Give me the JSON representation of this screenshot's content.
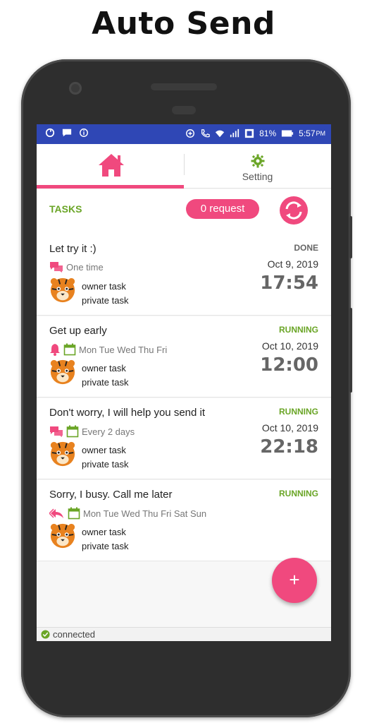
{
  "promo": {
    "title": "Auto Send"
  },
  "statusbar": {
    "left_icons": [
      "sync-icon",
      "chat-icon",
      "info-icon"
    ],
    "right_icons": [
      "data-saver-icon",
      "call-icon",
      "wifi-icon",
      "signal-icon",
      "signal-icon-2",
      "battery-icon"
    ],
    "battery": "81%",
    "time": "5:57",
    "ampm": "PM"
  },
  "tabs": {
    "home_icon": "home-icon",
    "setting_icon": "gear-icon",
    "setting_label": "Setting"
  },
  "header": {
    "tasks_label": "TASKS",
    "request_label": "0 request",
    "refresh_icon": "refresh-icon"
  },
  "tasks": [
    {
      "title": "Let try it :)",
      "icons": [
        "chat-icon"
      ],
      "schedule": "One time",
      "owner": "owner task",
      "privacy": "private task",
      "status": "DONE",
      "date": "Oct 9, 2019",
      "time": "17:54"
    },
    {
      "title": "Get up early",
      "icons": [
        "bell-icon",
        "calendar-icon"
      ],
      "schedule": "Mon Tue Wed Thu Fri",
      "owner": "owner task",
      "privacy": "private task",
      "status": "RUNNING",
      "date": "Oct 10, 2019",
      "time": "12:00"
    },
    {
      "title": "Don't worry, I will help you send it",
      "icons": [
        "chat-icon",
        "calendar-icon"
      ],
      "schedule": "Every 2 days",
      "owner": "owner task",
      "privacy": "private task",
      "status": "RUNNING",
      "date": "Oct 10, 2019",
      "time": "22:18"
    },
    {
      "title": "Sorry, I busy. Call me later",
      "icons": [
        "reply-all-icon",
        "calendar-icon"
      ],
      "schedule": "Mon Tue Wed Thu Fri Sat Sun",
      "owner": "owner task",
      "privacy": "private task",
      "status": "RUNNING",
      "date": "",
      "time": ""
    }
  ],
  "fab": {
    "label": "+"
  },
  "connection": {
    "label": "connected"
  },
  "colors": {
    "accent": "#f0497e",
    "green": "#6aa526",
    "statusbar": "#2f47b5"
  }
}
